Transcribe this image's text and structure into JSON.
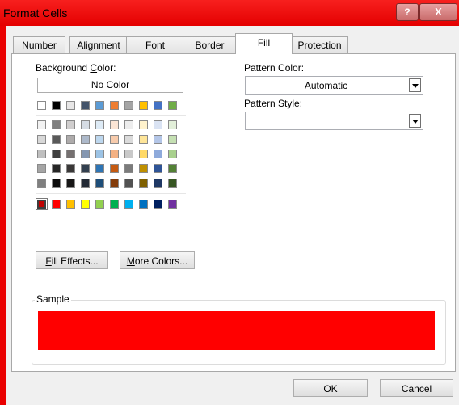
{
  "window": {
    "title": "Format Cells",
    "help_label": "?",
    "close_label": "X"
  },
  "tabs": [
    {
      "label": "Number"
    },
    {
      "label": "Alignment"
    },
    {
      "label": "Font"
    },
    {
      "label": "Border"
    },
    {
      "label": "Fill",
      "active": true
    },
    {
      "label": "Protection"
    }
  ],
  "fill": {
    "background_color_label_pre": "Background ",
    "background_color_label_key": "C",
    "background_color_label_post": "olor:",
    "no_color_label": "No Color",
    "fill_effects_pre": "",
    "fill_effects_key": "F",
    "fill_effects_post": "ill Effects...",
    "more_colors_pre": "",
    "more_colors_key": "M",
    "more_colors_post": "ore Colors...",
    "pattern_color_label": "Pattern Color:",
    "pattern_color_value": "Automatic",
    "pattern_style_label_key": "P",
    "pattern_style_label_post": "attern Style:",
    "pattern_style_value": "",
    "sample_label": "Sample",
    "sample_color": "#ff0000",
    "selected_color": "#c00000",
    "theme_top_row": [
      "#ffffff",
      "#000000",
      "#e7e6e6",
      "#44546a",
      "#5b9bd5",
      "#ed7d31",
      "#a5a5a5",
      "#ffc000",
      "#4472c4",
      "#70ad47"
    ],
    "theme_shades": [
      [
        "#f2f2f2",
        "#7f7f7f",
        "#d0cece",
        "#d6dce4",
        "#deebf6",
        "#fbe5d5",
        "#ededed",
        "#fff2cc",
        "#dae3f3",
        "#e2efd9"
      ],
      [
        "#d8d8d8",
        "#595959",
        "#aeabab",
        "#adb9ca",
        "#bdd7ee",
        "#f7cbac",
        "#dbdbdb",
        "#fee599",
        "#b4c6e7",
        "#c5e0b3"
      ],
      [
        "#bfbfbf",
        "#3f3f3f",
        "#757070",
        "#8496b0",
        "#9cc3e5",
        "#f4b183",
        "#c9c9c9",
        "#ffd965",
        "#8eaadb",
        "#a8d08d"
      ],
      [
        "#a5a5a5",
        "#262626",
        "#3a3838",
        "#323f4f",
        "#2e75b5",
        "#c55a11",
        "#7b7b7b",
        "#bf9000",
        "#2f5496",
        "#538135"
      ],
      [
        "#7f7f7f",
        "#0c0c0c",
        "#171616",
        "#222a35",
        "#1e4e79",
        "#833c0b",
        "#525252",
        "#7f6000",
        "#1f3864",
        "#375623"
      ]
    ],
    "standard_colors": [
      "#c00000",
      "#ff0000",
      "#ffc000",
      "#ffff00",
      "#92d050",
      "#00b050",
      "#00b0f0",
      "#0070c0",
      "#002060",
      "#7030a0"
    ]
  },
  "footer": {
    "ok_label": "OK",
    "cancel_label": "Cancel"
  }
}
